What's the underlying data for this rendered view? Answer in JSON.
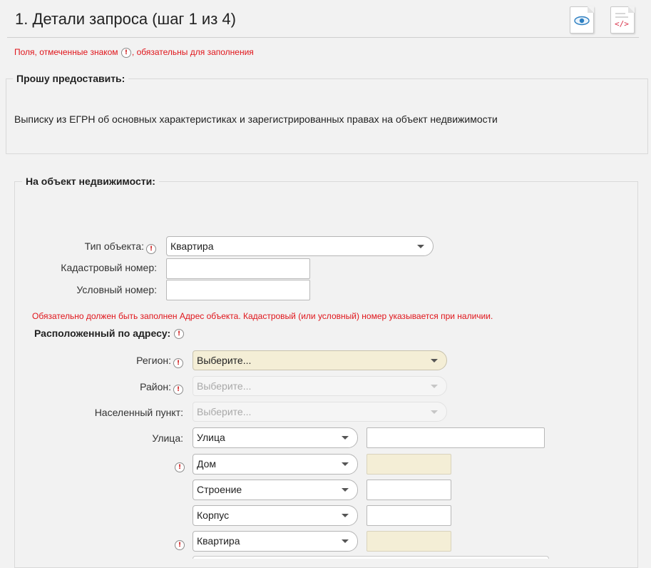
{
  "header": {
    "title": "1. Детали запроса (шаг 1 из 4)",
    "icons": [
      "preview-icon",
      "code-icon"
    ]
  },
  "required_note": {
    "before": "Поля, отмеченные знаком",
    "after": ", обязательны для заполнения",
    "icon_glyph": "!"
  },
  "request_section": {
    "legend": "Прошу предоставить:",
    "text": "Выписку из ЕГРН об основных характеристиках и зарегистрированных правах на объект недвижимости"
  },
  "object_section": {
    "legend": "На объект недвижимости:",
    "object_type_label": "Тип объекта:",
    "object_type_value": "Квартира",
    "cadastral_label": "Кадастровый номер:",
    "cadastral_value": "",
    "conditional_label": "Условный номер:",
    "conditional_value": "",
    "warning": "Обязательно должен быть заполнен Адрес объекта. Кадастровый (или условный) номер указывается при наличии.",
    "address_title": "Расположенный по адресу:",
    "region_label": "Регион:",
    "region_value": "Выберите...",
    "district_label": "Район:",
    "district_value": "Выберите...",
    "locality_label": "Населенный пункт:",
    "locality_value": "Выберите...",
    "street_label": "Улица:",
    "street_type": "Улица",
    "street_value": "",
    "house_type": "Дом",
    "house_value": "",
    "building_type": "Строение",
    "building_value": "",
    "block_type": "Корпус",
    "block_value": "",
    "apartment_type": "Квартира",
    "apartment_value": ""
  },
  "colors": {
    "required_red": "#e0151b",
    "highlight_beige": "#f4eed6",
    "background": "#f2f2f2"
  }
}
